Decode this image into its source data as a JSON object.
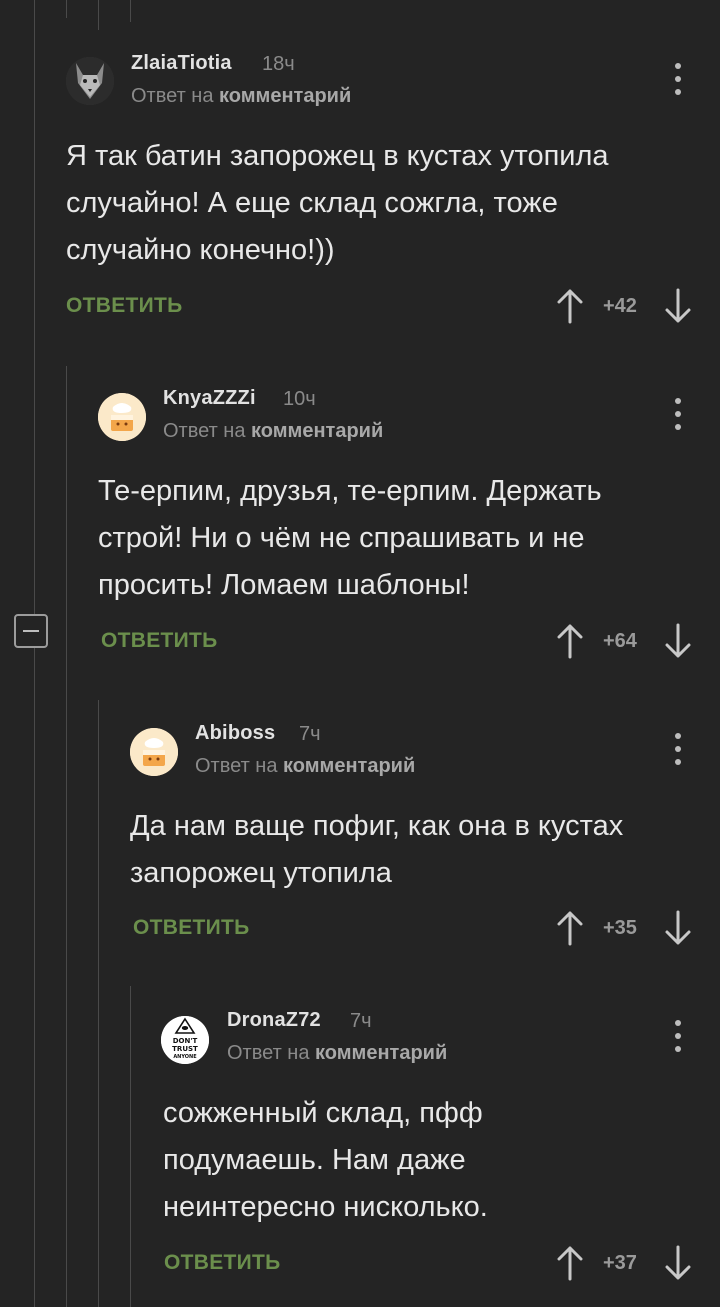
{
  "ui": {
    "reply_to_prefix": "Ответ на",
    "reply_to_target": "комментарий",
    "reply_label": "ОТВЕТИТЬ"
  },
  "comments": [
    {
      "author": "ZlaiaTiotia",
      "time": "18ч",
      "text": "Я так батин запорожец в кустах утопила\nслучайно! А еще склад сожгла, тоже\nслучайно конечно!))",
      "score": "+42",
      "avatar": "wolf-avatar"
    },
    {
      "author": "KnyaZZZi",
      "time": "10ч",
      "text": "Те-ерпим, друзья, те-ерпим. Держать\nстрой! Ни о чём не спрашивать и не\nпросить! Ломаем шаблоны!",
      "score": "+64",
      "avatar": "cake-avatar"
    },
    {
      "author": "Abiboss",
      "time": "7ч",
      "text": "Да нам ваще пофиг, как она в кустах\nзапорожец утопила",
      "score": "+35",
      "avatar": "cake-avatar"
    },
    {
      "author": "DronaZ72",
      "time": "7ч",
      "text": "сожженный склад, пфф\nподумаешь. Нам даже\nнеинтересно нисколько.",
      "score": "+37",
      "avatar": "dont-trust-anyone-avatar",
      "avatar_text": [
        "DON'T",
        "TRUST",
        "ANYONE"
      ]
    }
  ],
  "colors": {
    "background": "#242424",
    "reply_green": "#6b8f4c",
    "thread_line": "#4a4a4a"
  }
}
